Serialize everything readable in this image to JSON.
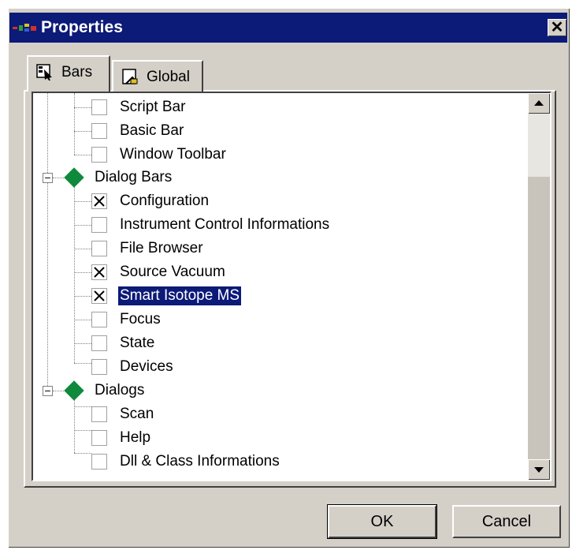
{
  "window": {
    "title": "Properties",
    "close_glyph": "✕"
  },
  "tabs": [
    {
      "label": "Bars",
      "icon": "bars-icon",
      "active": true
    },
    {
      "label": "Global",
      "icon": "global-icon",
      "active": false
    }
  ],
  "tree": {
    "items": [
      {
        "label": "Script Bar",
        "checked": false
      },
      {
        "label": "Basic Bar",
        "checked": false
      },
      {
        "label": "Window Toolbar",
        "checked": false
      },
      {
        "label": "Dialog Bars",
        "group": true,
        "expanded": true
      },
      {
        "label": "Configuration",
        "checked": true
      },
      {
        "label": "Instrument Control Informations",
        "checked": false
      },
      {
        "label": "File Browser",
        "checked": false
      },
      {
        "label": "Source Vacuum",
        "checked": true
      },
      {
        "label": "Smart Isotope MS",
        "checked": true,
        "selected": true
      },
      {
        "label": "Focus",
        "checked": false
      },
      {
        "label": "State",
        "checked": false
      },
      {
        "label": "Devices",
        "checked": false
      },
      {
        "label": "Dialogs",
        "group": true,
        "expanded": true
      },
      {
        "label": "Scan",
        "checked": false
      },
      {
        "label": "Help",
        "checked": false
      },
      {
        "label": "Dll & Class Informations",
        "checked": false
      }
    ],
    "expander_glyph": "−"
  },
  "buttons": {
    "ok": "OK",
    "cancel": "Cancel"
  },
  "colors": {
    "title_bar": "#0c1a78",
    "selection": "#0c1a78",
    "group_diamond": "#0f8a3c",
    "dialog_face": "#d4d0c8"
  }
}
